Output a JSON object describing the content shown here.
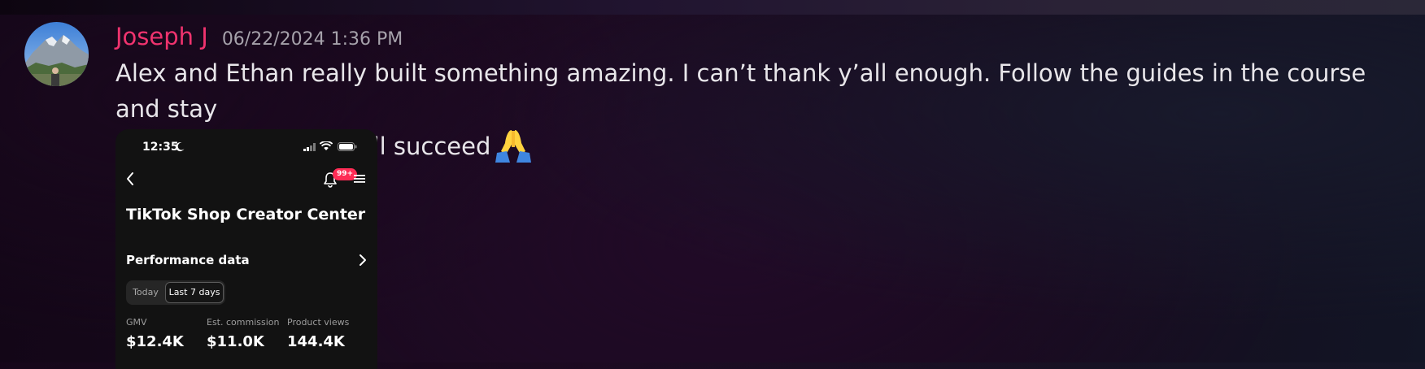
{
  "message": {
    "author": "Joseph J",
    "timestamp": "06/22/2024 1:36 PM",
    "text_line1": "Alex and Ethan really built something amazing. I can’t thank y’all enough. Follow the guides in the course and stay",
    "text_line2": "consistent and you will succeed",
    "emoji": "folded-hands-emoji",
    "author_color": "#f0336e"
  },
  "attachment": {
    "status_time": "12:35",
    "notification_badge": "99+",
    "title": "TikTok Shop Creator Center",
    "section_title": "Performance data",
    "toggle": {
      "options": [
        "Today",
        "Last 7 days"
      ],
      "selected": "Last 7 days"
    },
    "metrics": [
      {
        "label": "GMV",
        "value": "$12.4K"
      },
      {
        "label": "Est. commission",
        "value": "$11.0K"
      },
      {
        "label": "Product views",
        "value": "144.4K"
      }
    ],
    "badge_color": "#fe2c55"
  }
}
